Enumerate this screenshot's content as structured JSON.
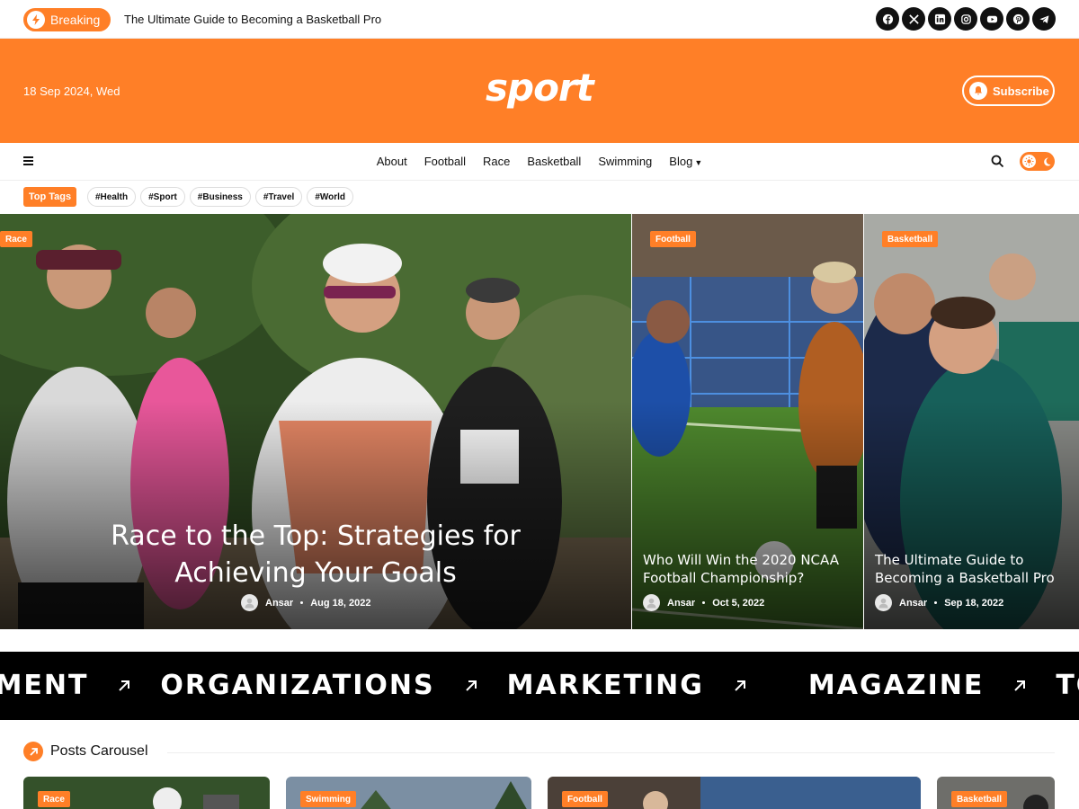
{
  "topbar": {
    "breaking_label": "Breaking",
    "ticker_text": "The Ultimate Guide to Becoming a Basketball Pro",
    "socials": [
      "facebook-icon",
      "x-icon",
      "linkedin-icon",
      "instagram-icon",
      "youtube-icon",
      "pinterest-icon",
      "telegram-icon"
    ]
  },
  "masthead": {
    "date": "18 Sep 2024, Wed",
    "logo": "sport",
    "subscribe_label": "Subscribe"
  },
  "nav": {
    "items": [
      "About",
      "Football",
      "Race",
      "Basketball",
      "Swimming",
      "Blog"
    ]
  },
  "tags": {
    "label": "Top Tags",
    "items": [
      "#Health",
      "#Sport",
      "#Business",
      "#Travel",
      "#World"
    ]
  },
  "hero": {
    "posts": [
      {
        "category": "Race",
        "title_line1": "Race to the Top: Strategies for",
        "title_line2": "Achieving Your Goals",
        "author": "Ansar",
        "date": "Aug 18, 2022"
      },
      {
        "category": "Football",
        "title_line1": "Who Will Win the 2020 NCAA",
        "title_line2": "Football Championship?",
        "author": "Ansar",
        "date": "Oct 5, 2022"
      },
      {
        "category": "Basketball",
        "title_line1": "The Ultimate Guide to",
        "title_line2": "Becoming a Basketball Pro",
        "author": "Ansar",
        "date": "Sep 18, 2022"
      }
    ]
  },
  "marquee": {
    "words": [
      "EMENT",
      "ORGANIZATIONS",
      "MARKETING",
      "MAGAZINE",
      "TODAY NE"
    ]
  },
  "carousel": {
    "title": "Posts Carousel",
    "cards": [
      {
        "category": "Race"
      },
      {
        "category": "Swimming"
      },
      {
        "category": "Football"
      },
      {
        "category": "Basketball"
      }
    ]
  },
  "colors": {
    "accent": "#ff7f27",
    "dark": "#000000"
  }
}
